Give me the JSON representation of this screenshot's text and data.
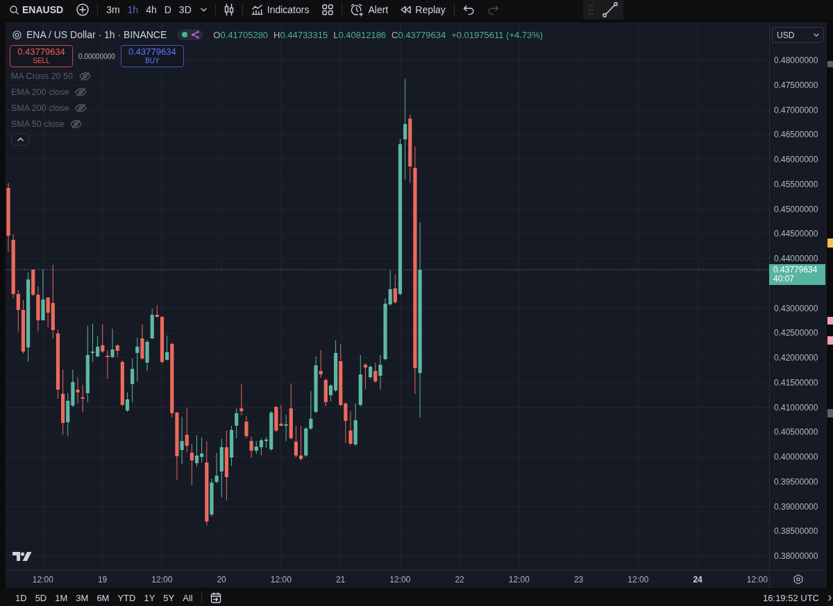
{
  "toolbar": {
    "symbol": "ENAUSD",
    "intervals": [
      {
        "label": "3m",
        "selected": false
      },
      {
        "label": "1h",
        "selected": true
      },
      {
        "label": "4h",
        "selected": false
      },
      {
        "label": "D",
        "selected": false
      },
      {
        "label": "3D",
        "selected": false
      }
    ],
    "indicators_label": "Indicators",
    "alert_label": "Alert",
    "replay_label": "Replay",
    "history": [
      {
        "kind": "undo",
        "disabled": false
      },
      {
        "kind": "redo",
        "disabled": true
      }
    ]
  },
  "legend": {
    "title": "ENA / US Dollar · 1h · BINANCE",
    "rising": true,
    "ohlc": [
      {
        "label": "O",
        "value": "0.41705280"
      },
      {
        "label": "H",
        "value": "0.44733315"
      },
      {
        "label": "L",
        "value": "0.40812186"
      },
      {
        "label": "C",
        "value": "0.43779634"
      }
    ],
    "change": "+0.01975611 (+4.73%)"
  },
  "trade": {
    "sell": {
      "price": "0.43779634",
      "label": "SELL"
    },
    "spread": "0.00000000",
    "buy": {
      "price": "0.43779634",
      "label": "BUY"
    }
  },
  "indicators": {
    "expanded": true,
    "items": [
      {
        "label": "MA Cross 20 50",
        "visible": false
      },
      {
        "label": "EMA 200 close",
        "visible": false
      },
      {
        "label": "SMA 200 close",
        "visible": false
      },
      {
        "label": "SMA 50 close",
        "visible": false
      }
    ]
  },
  "price_scale": {
    "currency": "USD",
    "labels_above": [
      "0.48000000",
      "0.47500000",
      "0.47000000",
      "0.46500000",
      "0.46000000",
      "0.45500000",
      "0.45000000",
      "0.44500000",
      "0.44000000"
    ],
    "current_price": {
      "price": "0.43779634",
      "countdown": "40:07"
    },
    "labels_below": [
      "0.43000000",
      "0.42500000",
      "0.42000000",
      "0.41500000",
      "0.41000000",
      "0.40500000",
      "0.40000000",
      "0.39500000",
      "0.39000000",
      "0.38500000",
      "0.38000000"
    ]
  },
  "time_scale": {
    "labels": [
      {
        "label": "12:00",
        "emphasized": false
      },
      {
        "label": "19",
        "emphasized": false
      },
      {
        "label": "12:00",
        "emphasized": false
      },
      {
        "label": "20",
        "emphasized": false
      },
      {
        "label": "12:00",
        "emphasized": false
      },
      {
        "label": "21",
        "emphasized": false
      },
      {
        "label": "12:00",
        "emphasized": false
      },
      {
        "label": "22",
        "emphasized": false
      },
      {
        "label": "12:00",
        "emphasized": false
      },
      {
        "label": "23",
        "emphasized": false
      },
      {
        "label": "12:00",
        "emphasized": false
      },
      {
        "label": "24",
        "emphasized": true
      },
      {
        "label": "12:00",
        "emphasized": false
      }
    ]
  },
  "bottom_bar": {
    "ranges": [
      "1D",
      "5D",
      "1M",
      "3M",
      "6M",
      "YTD",
      "1Y",
      "5Y",
      "All"
    ],
    "clock": "16:19:52 UTC"
  },
  "edge_markers": [
    {
      "color": "#5d606b"
    },
    {
      "color": "#f2c14e"
    },
    {
      "color": "#f5a3b8"
    },
    {
      "color": "#f5a3b8"
    },
    {
      "color": "#5d606b"
    }
  ]
}
